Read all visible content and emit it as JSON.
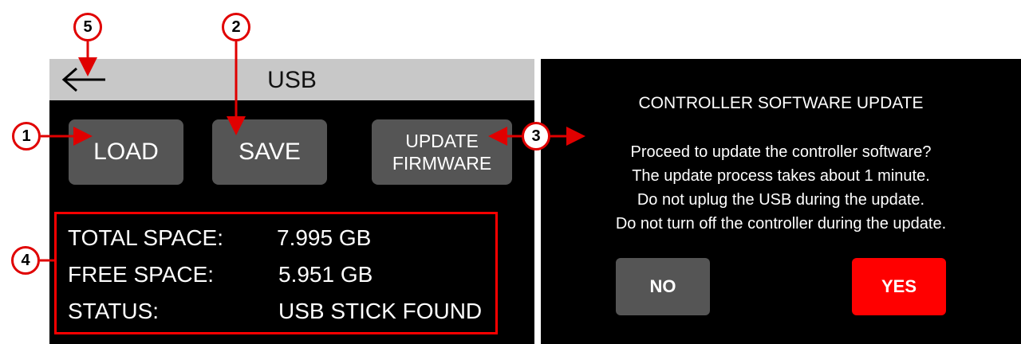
{
  "usb_screen": {
    "title": "USB",
    "buttons": {
      "load": "LOAD",
      "save": "SAVE",
      "update_line1": "UPDATE",
      "update_line2": "FIRMWARE"
    },
    "info": {
      "total_label": "TOTAL SPACE:",
      "total_value": "7.995 GB",
      "free_label": "FREE SPACE:",
      "free_value": "5.951 GB",
      "status_label": "STATUS:",
      "status_value": "USB STICK FOUND"
    }
  },
  "dialog": {
    "title": "CONTROLLER SOFTWARE UPDATE",
    "message_lines": [
      "Proceed to update the controller software?",
      "The update process takes about 1 minute.",
      "Do not uplug the USB during the update.",
      "Do not turn off the controller during the update."
    ],
    "no_label": "NO",
    "yes_label": "YES"
  },
  "callouts": {
    "c1": "1",
    "c2": "2",
    "c3": "3",
    "c4": "4",
    "c5": "5"
  },
  "colors": {
    "accent_red": "#ff0000",
    "button_gray": "#555555",
    "titlebar_gray": "#c8c8c8"
  },
  "icons": {
    "back": "back-arrow-icon"
  }
}
